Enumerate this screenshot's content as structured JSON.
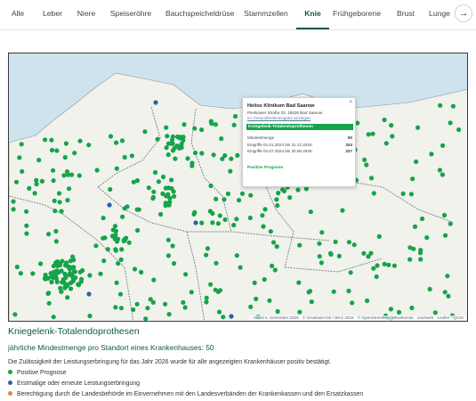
{
  "tabs": [
    {
      "label": "Alle",
      "active": false
    },
    {
      "label": "Leber",
      "active": false
    },
    {
      "label": "Niere",
      "active": false
    },
    {
      "label": "Speiseröhre",
      "active": false
    },
    {
      "label": "Bauchspeicheldrüse",
      "active": false
    },
    {
      "label": "Stammzellen",
      "active": false
    },
    {
      "label": "Knie",
      "active": true
    },
    {
      "label": "Frühgeborene",
      "active": false
    },
    {
      "label": "Brust",
      "active": false
    },
    {
      "label": "Lunge",
      "active": false
    }
  ],
  "tabs_next_glyph": "→",
  "map": {
    "attribution": [
      "Stand 6. Dezember 2025",
      "© GeoBasis-DE / BKG 2019",
      "© OpenStreetMap Mitwirkende",
      "vas2web",
      "Leaflet",
      "QGIS"
    ],
    "colors": {
      "positive": "#16a34a",
      "first_time": "#2f5fa8",
      "authorized": "#e8843c",
      "land_border": "#6f7a86",
      "water": "#cfe3ee"
    },
    "popup": {
      "title": "Helios Klinikum Bad Saarow",
      "address": "Pieskower Straße 33, 15526 Bad Saarow",
      "link": "Im Gesundheitsnavigator anzeigen",
      "section": "Kniegelenk-Totalendoprothesen",
      "rows": [
        {
          "label": "Mindestmenge",
          "value": "50"
        },
        {
          "label": "Eingriffe 01.01.2024 bis 31.12.2024:",
          "value": "204"
        },
        {
          "label": "Eingriffe 01.07.2024 bis 30.06.2025:",
          "value": "227"
        }
      ],
      "status": "Positive Prognose",
      "close": "×"
    }
  },
  "heading": "Kniegelenk-Totalendoprothesen",
  "subheading": "jährliche Mindestmenge pro Standort eines Krankenhauses: 50",
  "note": "Die Zulässigkeit der Leistungserbringung für das Jahr 2026 wurde für alle angezeigten Krankenhäuser positiv bestätigt.",
  "legend": [
    {
      "label": "Positive Prognose",
      "color": "#16a34a"
    },
    {
      "label": "Erstmalige oder erneute Leistungserbringung",
      "color": "#2f5fa8"
    },
    {
      "label": "Berechtigung durch die Landesbehörde im Einvernehmen mit den Landesverbänden der Krankenkassen und den Ersatzkassen",
      "color": "#e8843c"
    }
  ]
}
